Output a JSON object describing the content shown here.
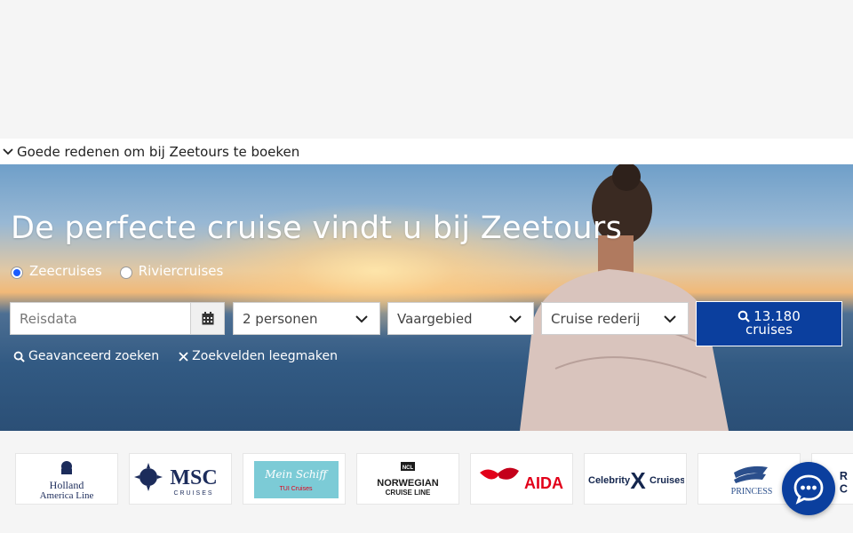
{
  "reasons": {
    "label": "Goede redenen om bij Zeetours te boeken"
  },
  "hero": {
    "title": "De perfecte cruise vindt u bij Zeetours",
    "radios": [
      {
        "label": "Zeecruises",
        "checked": true
      },
      {
        "label": "Riviercruises",
        "checked": false
      }
    ]
  },
  "search": {
    "date_placeholder": "Reisdata",
    "persons": "2 personen",
    "area": "Vaargebied",
    "cruise_line": "Cruise rederij",
    "button_count": "13.180",
    "button_unit": "cruises"
  },
  "links": {
    "advanced": "Geavanceerd zoeken",
    "clear": "Zoekvelden leegmaken"
  },
  "logos": [
    {
      "name": "Holland",
      "line2": "America Line"
    },
    {
      "name": "MSC",
      "line2": "CRUISES"
    },
    {
      "name": "Mein Schiff",
      "line2": "TUI Cruises"
    },
    {
      "name": "NORWEGIAN",
      "line2": "CRUISE LINE",
      "badge": "NCL"
    },
    {
      "name": "AIDA"
    },
    {
      "name": "Celebrity",
      "mark": "X",
      "line2": "Cruises"
    },
    {
      "name": "PRINCESS"
    },
    {
      "name": "R",
      "line2": "C"
    }
  ],
  "colors": {
    "brand_blue": "#0b3f9e",
    "radio_blue": "#1a5cff",
    "msc_navy": "#1c2c5b",
    "aida_red": "#e2001a"
  },
  "icons": [
    "chevron-down-icon",
    "calendar-icon",
    "search-icon",
    "close-icon",
    "chat-icon"
  ]
}
